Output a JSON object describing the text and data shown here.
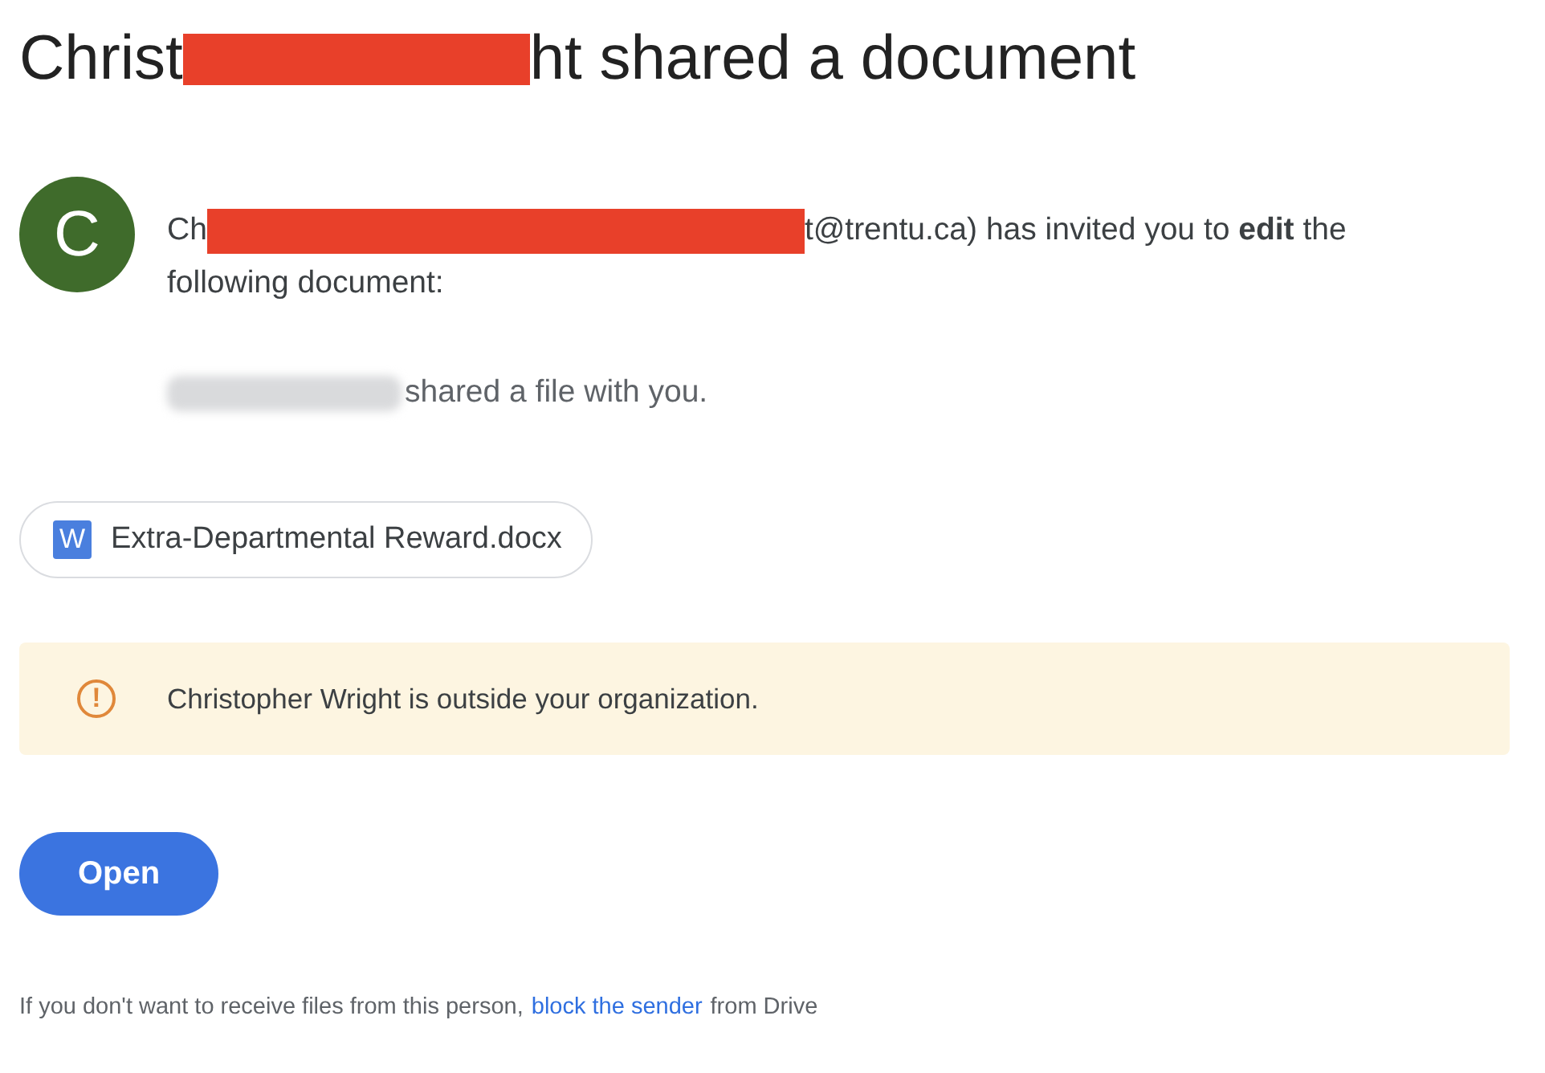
{
  "heading": {
    "before": "Christ",
    "after": "ht shared a document"
  },
  "invite": {
    "avatar_letter": "C",
    "before": "Ch",
    "after": "t@trentu.ca) has invited you to **edit** the",
    "continued": "following document:"
  },
  "shared_note": "shared a file with you.",
  "attachment": {
    "icon_letter": "W",
    "name": "Extra-Departmental Reward.docx"
  },
  "warning": {
    "icon": "!",
    "text": "Christopher Wright is outside your organization."
  },
  "open_button": "Open",
  "footer": {
    "before": "If you don't want to receive files from this person,",
    "link": "block the sender",
    "after": "from Drive"
  }
}
